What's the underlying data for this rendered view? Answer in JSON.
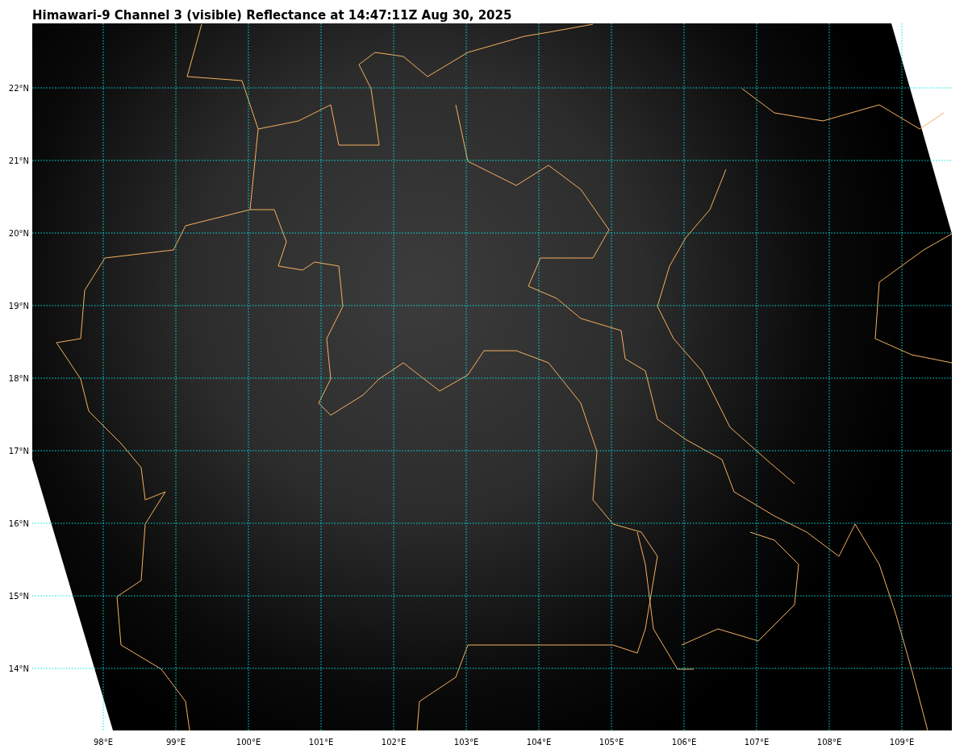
{
  "title": "Himawari-9 Channel 3 (visible) Reflectance at 14:47:11Z Aug 30, 2025",
  "longitude_labels": [
    "98°E",
    "99°E",
    "100°E",
    "101°E",
    "102°E",
    "103°E",
    "104°E",
    "105°E",
    "106°E",
    "107°E",
    "108°E",
    "109°E"
  ],
  "latitude_labels": [
    "22°N",
    "21°N",
    "20°N",
    "19°N",
    "18°N",
    "17°N",
    "16°N",
    "15°N",
    "14°N"
  ]
}
